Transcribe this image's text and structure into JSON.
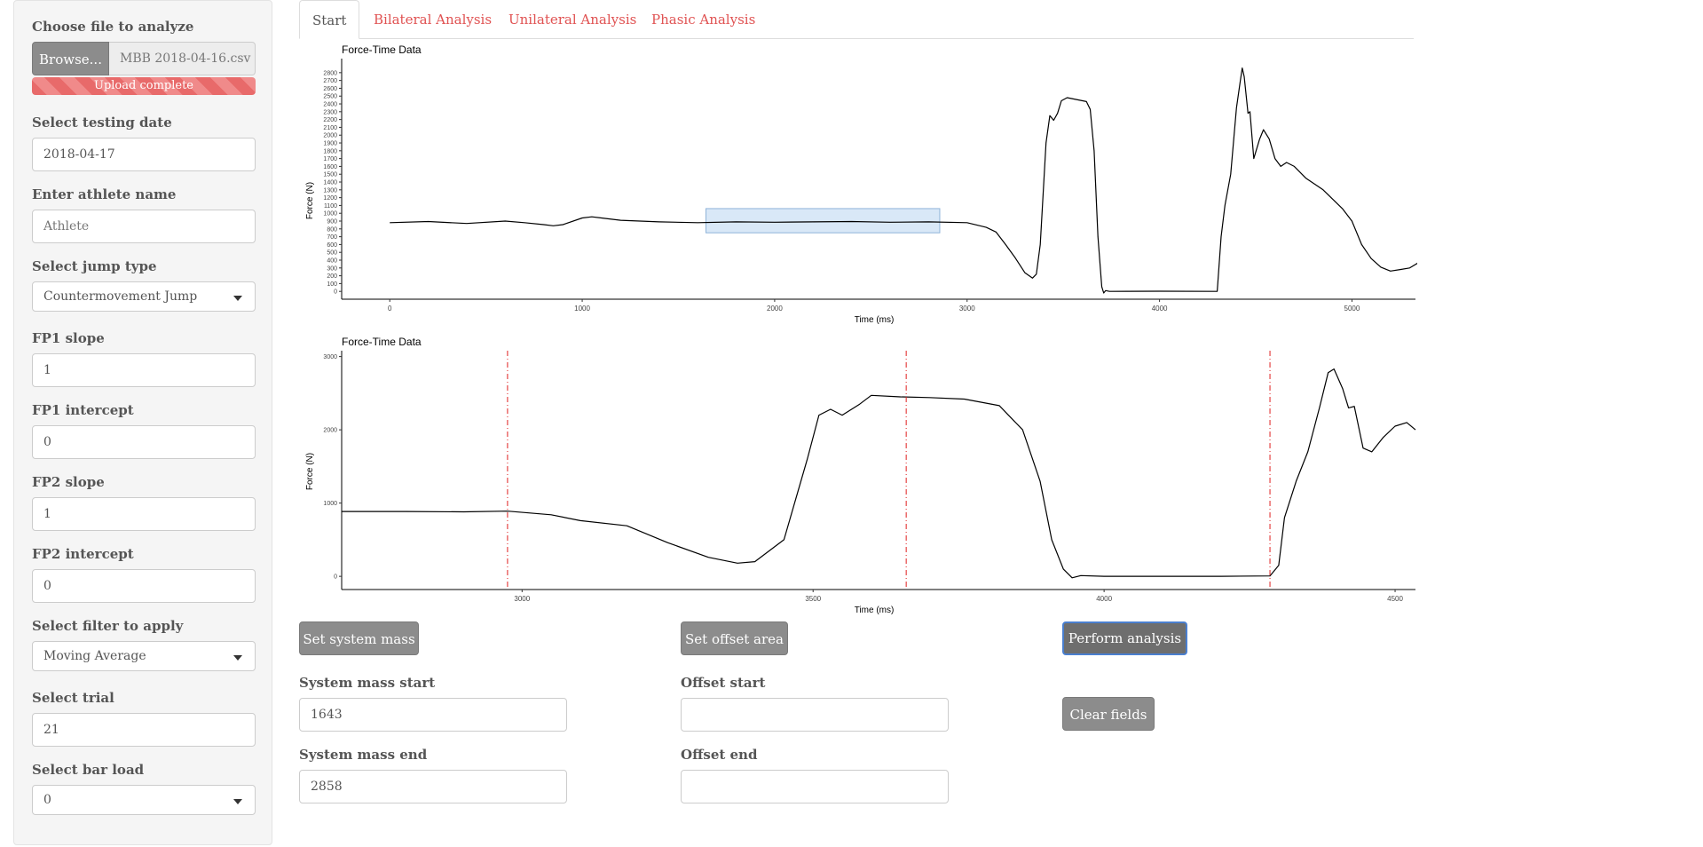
{
  "sidebar": {
    "file": {
      "label": "Choose file to analyze",
      "browse_label": "Browse...",
      "file_name": "MBB 2018-04-16.csv",
      "progress_text": "Upload complete",
      "progress_color": "#e86a6a"
    },
    "date": {
      "label": "Select testing date",
      "value": "2018-04-17"
    },
    "athlete": {
      "label": "Enter athlete name",
      "placeholder": "Athlete"
    },
    "jump_type": {
      "label": "Select jump type",
      "value": "Countermovement Jump"
    },
    "fp1_slope": {
      "label": "FP1 slope",
      "value": "1"
    },
    "fp1_intercept": {
      "label": "FP1 intercept",
      "value": "0"
    },
    "fp2_slope": {
      "label": "FP2 slope",
      "value": "1"
    },
    "fp2_intercept": {
      "label": "FP2 intercept",
      "value": "0"
    },
    "filter": {
      "label": "Select filter to apply",
      "value": "Moving Average"
    },
    "trial": {
      "label": "Select trial",
      "value": "21"
    },
    "bar_load": {
      "label": "Select bar load",
      "value": "0"
    }
  },
  "tabs": [
    {
      "label": "Start",
      "active": true
    },
    {
      "label": "Bilateral Analysis",
      "active": false
    },
    {
      "label": "Unilateral Analysis",
      "active": false
    },
    {
      "label": "Phasic Analysis",
      "active": false
    }
  ],
  "accent_color": "#e05252",
  "chart_data": [
    {
      "type": "line",
      "title": "Force-Time Data",
      "xlabel": "Time (ms)",
      "ylabel": "Force (N)",
      "xlim": [
        -250,
        5330
      ],
      "ylim": [
        -100,
        2980
      ],
      "x_ticks": [
        0,
        1000,
        2000,
        3000,
        4000,
        5000
      ],
      "y_ticks": [
        0,
        100,
        200,
        300,
        400,
        500,
        600,
        700,
        800,
        900,
        1000,
        1100,
        1200,
        1300,
        1400,
        1500,
        1600,
        1700,
        1800,
        1900,
        2000,
        2100,
        2200,
        2300,
        2400,
        2500,
        2600,
        2700,
        2800
      ],
      "grid": false,
      "selection": {
        "x_start": 1643,
        "x_end": 2858,
        "y_start": 750,
        "y_end": 1060,
        "color": "#cfe2f5"
      },
      "series": [
        {
          "color": "#000000",
          "points": [
            [
              0,
              880
            ],
            [
              200,
              895
            ],
            [
              400,
              870
            ],
            [
              600,
              900
            ],
            [
              700,
              880
            ],
            [
              800,
              855
            ],
            [
              850,
              840
            ],
            [
              900,
              855
            ],
            [
              1000,
              940
            ],
            [
              1050,
              955
            ],
            [
              1100,
              940
            ],
            [
              1200,
              910
            ],
            [
              1400,
              890
            ],
            [
              1600,
              880
            ],
            [
              1800,
              890
            ],
            [
              2000,
              885
            ],
            [
              2200,
              890
            ],
            [
              2400,
              895
            ],
            [
              2600,
              885
            ],
            [
              2800,
              890
            ],
            [
              3000,
              880
            ],
            [
              3050,
              850
            ],
            [
              3100,
              820
            ],
            [
              3150,
              760
            ],
            [
              3200,
              600
            ],
            [
              3250,
              430
            ],
            [
              3300,
              240
            ],
            [
              3340,
              170
            ],
            [
              3360,
              220
            ],
            [
              3380,
              600
            ],
            [
              3410,
              1900
            ],
            [
              3430,
              2250
            ],
            [
              3450,
              2190
            ],
            [
              3470,
              2280
            ],
            [
              3490,
              2440
            ],
            [
              3520,
              2480
            ],
            [
              3580,
              2450
            ],
            [
              3620,
              2430
            ],
            [
              3640,
              2330
            ],
            [
              3660,
              1800
            ],
            [
              3680,
              700
            ],
            [
              3700,
              60
            ],
            [
              3710,
              -20
            ],
            [
              3720,
              10
            ],
            [
              3740,
              0
            ],
            [
              4000,
              2
            ],
            [
              4300,
              0
            ],
            [
              4320,
              700
            ],
            [
              4340,
              1100
            ],
            [
              4370,
              1500
            ],
            [
              4400,
              2350
            ],
            [
              4420,
              2700
            ],
            [
              4430,
              2860
            ],
            [
              4440,
              2750
            ],
            [
              4460,
              2280
            ],
            [
              4470,
              2300
            ],
            [
              4490,
              1700
            ],
            [
              4520,
              1950
            ],
            [
              4540,
              2070
            ],
            [
              4570,
              1950
            ],
            [
              4600,
              1700
            ],
            [
              4630,
              1600
            ],
            [
              4660,
              1650
            ],
            [
              4700,
              1600
            ],
            [
              4760,
              1450
            ],
            [
              4850,
              1300
            ],
            [
              4950,
              1060
            ],
            [
              5000,
              900
            ],
            [
              5050,
              600
            ],
            [
              5100,
              420
            ],
            [
              5150,
              310
            ],
            [
              5200,
              260
            ],
            [
              5250,
              280
            ],
            [
              5300,
              300
            ],
            [
              5340,
              360
            ],
            [
              5380,
              500
            ]
          ]
        }
      ]
    },
    {
      "type": "line",
      "title": "Force-Time Data",
      "xlabel": "Time (ms)",
      "ylabel": "Force (N)",
      "xlim": [
        2690,
        4535
      ],
      "ylim": [
        -180,
        3080
      ],
      "x_ticks": [
        3000,
        3500,
        4000,
        4500
      ],
      "y_ticks": [
        0,
        1000,
        2000,
        3000
      ],
      "grid": false,
      "markers": {
        "x": [
          2975,
          3660,
          4285
        ],
        "color": "#e02020"
      },
      "series": [
        {
          "color": "#000000",
          "points": [
            [
              2690,
              885
            ],
            [
              2800,
              885
            ],
            [
              2900,
              880
            ],
            [
              2975,
              890
            ],
            [
              3050,
              840
            ],
            [
              3100,
              760
            ],
            [
              3180,
              690
            ],
            [
              3250,
              460
            ],
            [
              3320,
              260
            ],
            [
              3370,
              180
            ],
            [
              3400,
              200
            ],
            [
              3450,
              500
            ],
            [
              3490,
              1600
            ],
            [
              3510,
              2200
            ],
            [
              3530,
              2280
            ],
            [
              3550,
              2200
            ],
            [
              3580,
              2350
            ],
            [
              3600,
              2470
            ],
            [
              3650,
              2450
            ],
            [
              3700,
              2440
            ],
            [
              3760,
              2420
            ],
            [
              3820,
              2330
            ],
            [
              3860,
              2000
            ],
            [
              3890,
              1300
            ],
            [
              3910,
              500
            ],
            [
              3930,
              100
            ],
            [
              3945,
              -20
            ],
            [
              3960,
              10
            ],
            [
              4000,
              0
            ],
            [
              4200,
              0
            ],
            [
              4285,
              5
            ],
            [
              4300,
              150
            ],
            [
              4310,
              800
            ],
            [
              4330,
              1300
            ],
            [
              4350,
              1700
            ],
            [
              4370,
              2300
            ],
            [
              4385,
              2780
            ],
            [
              4395,
              2830
            ],
            [
              4410,
              2560
            ],
            [
              4420,
              2300
            ],
            [
              4430,
              2320
            ],
            [
              4445,
              1750
            ],
            [
              4460,
              1700
            ],
            [
              4480,
              1900
            ],
            [
              4500,
              2050
            ],
            [
              4520,
              2100
            ],
            [
              4535,
              2000
            ]
          ]
        }
      ]
    }
  ],
  "controls": {
    "set_system_mass": "Set system mass",
    "set_offset_area": "Set offset area",
    "perform_analysis": "Perform analysis",
    "clear_fields": "Clear fields",
    "system_mass_start": {
      "label": "System mass start",
      "value": "1643"
    },
    "system_mass_end": {
      "label": "System mass end",
      "value": "2858"
    },
    "offset_start": {
      "label": "Offset start",
      "value": ""
    },
    "offset_end": {
      "label": "Offset end",
      "value": ""
    }
  }
}
